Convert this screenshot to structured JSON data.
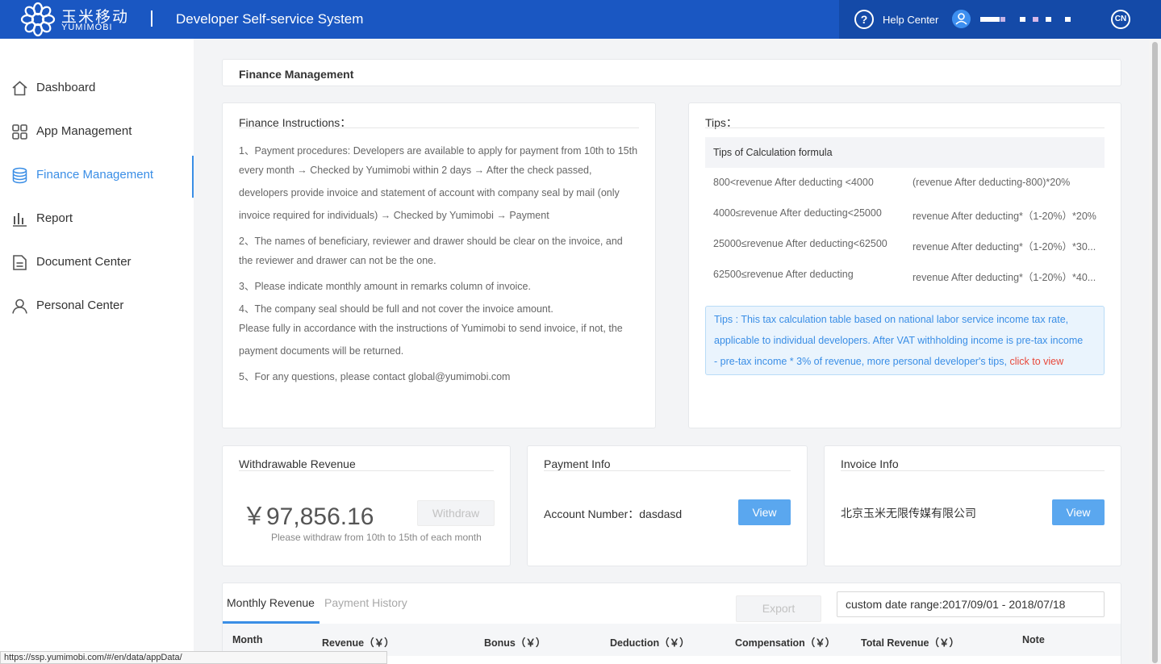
{
  "header": {
    "logo_cn": "玉米移动",
    "logo_en": "YUMIMOBI",
    "system_title": "Developer Self-service System",
    "help_label": "Help Center",
    "lang_label": "CN",
    "brand_color": "#1a57c2"
  },
  "sidebar": {
    "items": [
      {
        "label": "Dashboard",
        "icon": "home-icon"
      },
      {
        "label": "App Management",
        "icon": "grid-icon"
      },
      {
        "label": "Finance Management",
        "icon": "coins-icon",
        "active": true
      },
      {
        "label": "Report",
        "icon": "bar-chart-icon"
      },
      {
        "label": "Document Center",
        "icon": "document-icon"
      },
      {
        "label": "Personal Center",
        "icon": "user-icon"
      }
    ]
  },
  "page": {
    "breadcrumb": "Finance Management"
  },
  "instructions": {
    "title": "Finance Instructions：",
    "lines": [
      "1、Payment procedures: Developers are available to apply for payment from 10th to 15th",
      "every month → Checked by Yumimobi within 2 days → After the check passed,",
      "developers provide invoice and statement of account with company seal by mail (only",
      "invoice required for individuals) → Checked by Yumimobi → Payment",
      "2、The names of beneficiary, reviewer and drawer should be clear on the invoice, and",
      "the reviewer and drawer can not be the one.",
      "3、Please indicate monthly amount in remarks column of invoice.",
      "4、The company seal should be full and not cover the invoice amount.",
      "Please fully in accordance with the instructions of Yumimobi to send invoice, if not, the",
      "payment documents will be returned.",
      "5、For any questions, please contact global@yumimobi.com"
    ]
  },
  "tips": {
    "title": "Tips：",
    "table_title": "Tips of Calculation formula",
    "rows": [
      {
        "range": "800<revenue After deducting <4000",
        "formula": "(revenue After deducting-800)*20%"
      },
      {
        "range": "4000≤revenue After deducting<25000",
        "formula": "revenue After deducting*（1-20%）*20%"
      },
      {
        "range": "25000≤revenue After deducting<62500",
        "formula": "revenue After deducting*（1-20%）*30..."
      },
      {
        "range": "62500≤revenue After deducting",
        "formula": "revenue After deducting*（1-20%）*40..."
      }
    ],
    "notice_lines": [
      "Tips : This tax calculation table based on national labor service income tax rate,",
      "applicable to individual developers. After VAT withholding income is pre-tax income",
      "- pre-tax income * 3% of revenue, more personal developer's tips, "
    ],
    "notice_link": "click to view"
  },
  "withdrawable": {
    "title": "Withdrawable Revenue",
    "amount": "￥97,856.16",
    "button": "Withdraw",
    "hint": "Please withdraw from 10th to 15th of each month"
  },
  "payment_info": {
    "title": "Payment Info",
    "account_label": "Account Number：dasdasd",
    "button": "View"
  },
  "invoice_info": {
    "title": "Invoice Info",
    "company": "北京玉米无限传媒有限公司",
    "button": "View"
  },
  "revenue_panel": {
    "tabs": [
      "Monthly Revenue",
      "Payment History"
    ],
    "export_label": "Export",
    "date_range": "custom date range:2017/09/01 - 2018/07/18",
    "columns": [
      "Month",
      "Revenue（￥）",
      "Bonus（￥）",
      "Deduction（￥）",
      "Compensation（￥）",
      "Total Revenue（￥）",
      "Note"
    ]
  },
  "status_bar": {
    "url": "https://ssp.yumimobi.com/#/en/data/appData/"
  }
}
